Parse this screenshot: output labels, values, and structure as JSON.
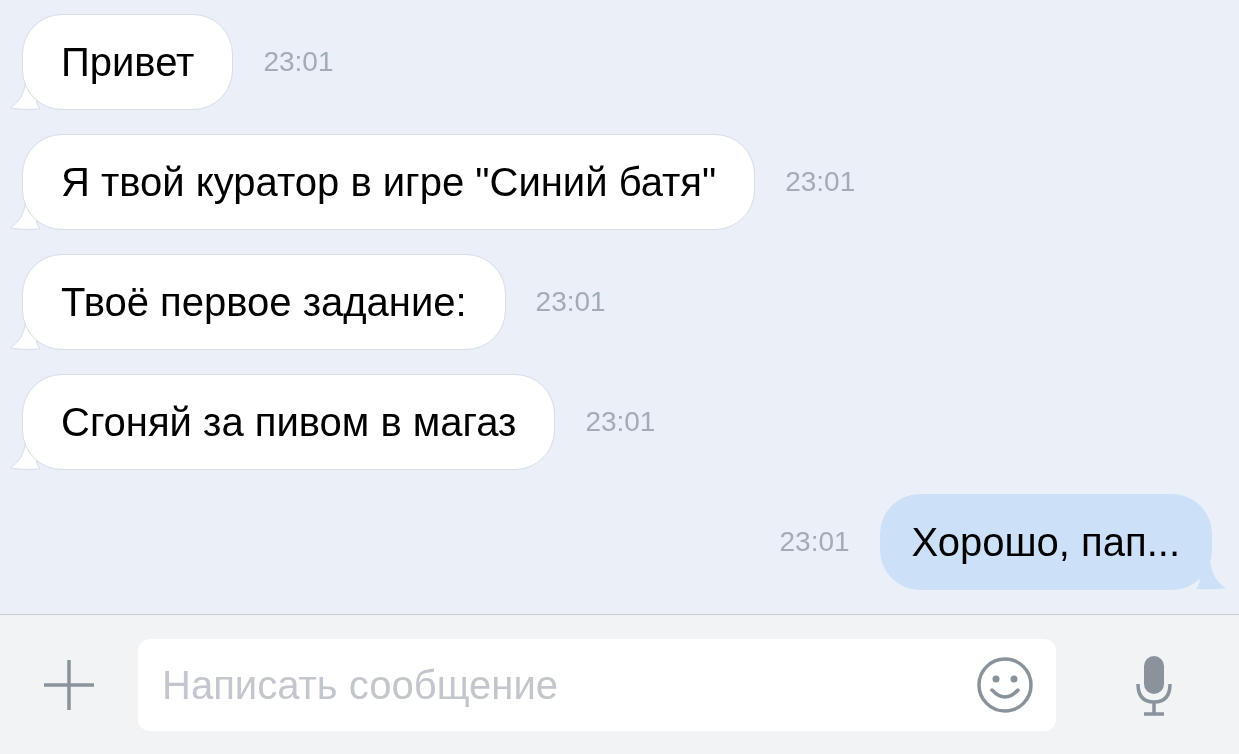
{
  "messages": [
    {
      "text": "Привет",
      "time": "23:01",
      "outgoing": false
    },
    {
      "text": "Я твой куратор в игре \"Синий батя\"",
      "time": "23:01",
      "outgoing": false
    },
    {
      "text": "Твоё первое задание:",
      "time": "23:01",
      "outgoing": false
    },
    {
      "text": "Сгоняй за пивом в магаз",
      "time": "23:01",
      "outgoing": false
    },
    {
      "text": "Хорошо, пап...",
      "time": "23:01",
      "outgoing": true
    }
  ],
  "composer": {
    "placeholder": "Написать сообщение"
  }
}
